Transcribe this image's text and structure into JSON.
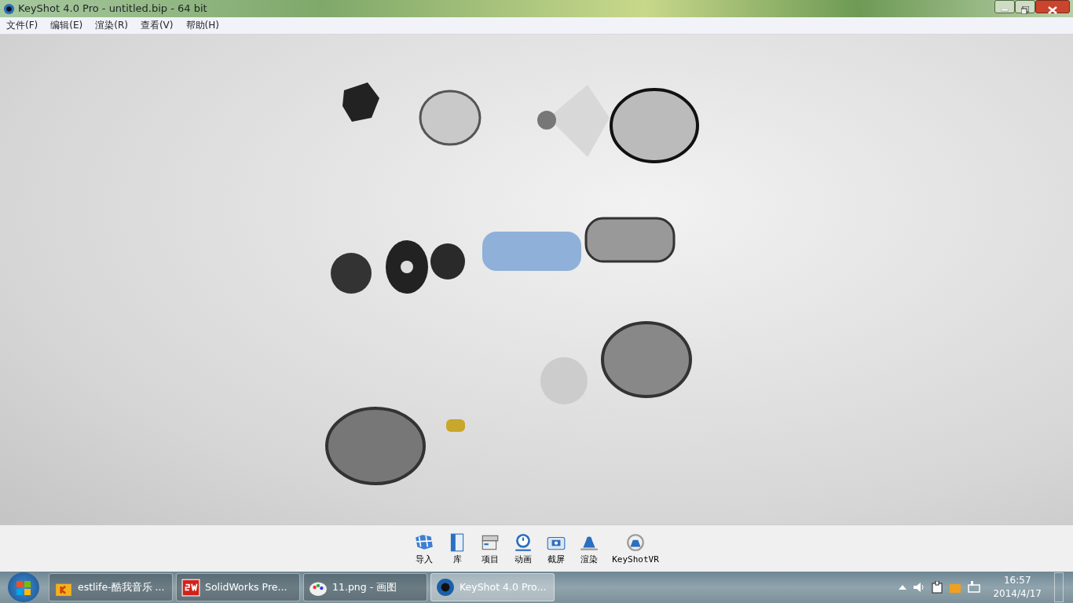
{
  "window": {
    "title": "KeyShot 4.0 Pro  - untitled.bip  - 64 bit"
  },
  "menu": [
    {
      "label": "文件(F)"
    },
    {
      "label": "编辑(E)"
    },
    {
      "label": "渲染(R)"
    },
    {
      "label": "查看(V)"
    },
    {
      "label": "帮助(H)"
    }
  ],
  "toolbar": [
    {
      "label": "导入",
      "kind": "import"
    },
    {
      "label": "库",
      "kind": "library"
    },
    {
      "label": "项目",
      "kind": "project"
    },
    {
      "label": "动画",
      "kind": "animation"
    },
    {
      "label": "截屏",
      "kind": "screenshot"
    },
    {
      "label": "渲染",
      "kind": "render"
    },
    {
      "label": "KeyShotVR",
      "kind": "vr"
    }
  ],
  "taskbar": {
    "items": [
      {
        "label": "estlife-酷我音乐 ...",
        "kind": "music",
        "selected": false
      },
      {
        "label": "SolidWorks Pre...",
        "kind": "sw",
        "selected": false
      },
      {
        "label": "11.png - 画图",
        "kind": "paint",
        "selected": false
      },
      {
        "label": "KeyShot 4.0 Pro...",
        "kind": "keyshot",
        "selected": true
      }
    ],
    "clock": {
      "time": "16:57",
      "date": "2014/4/17"
    }
  }
}
